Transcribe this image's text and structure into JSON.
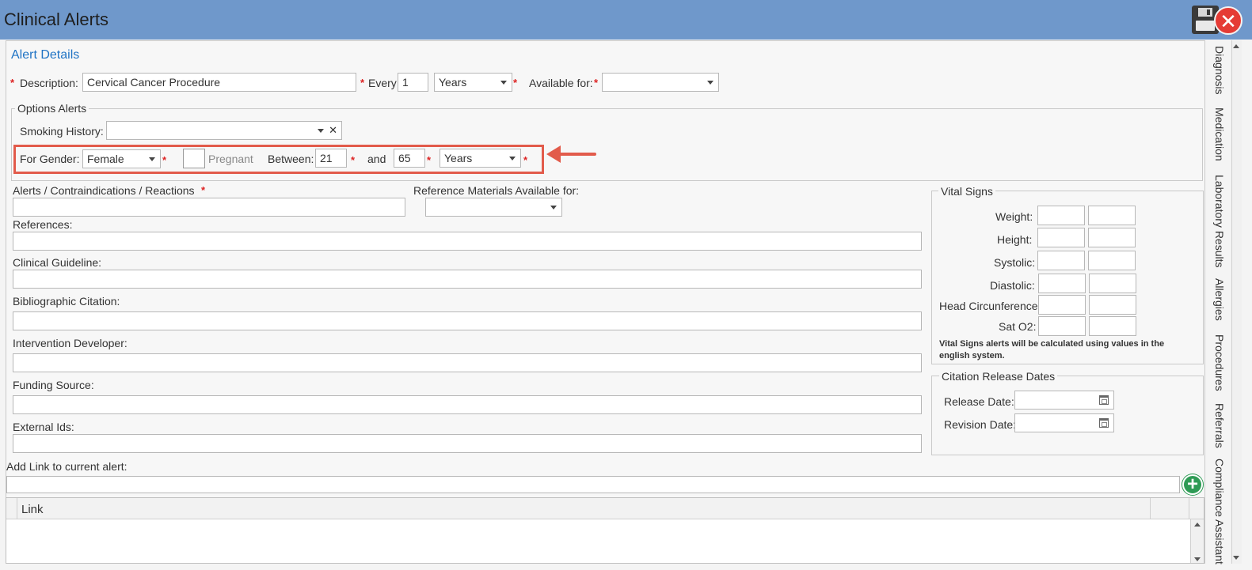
{
  "window": {
    "title": "Clinical Alerts"
  },
  "alert_details": {
    "title": "Alert Details",
    "description_label": "Description:",
    "description_value": "Cervical Cancer Procedure",
    "every_label": "Every:",
    "every_value": "1",
    "every_unit": "Years",
    "available_for_label": "Available for:",
    "available_for_value": "",
    "required_mark": "*"
  },
  "options_alerts": {
    "title": "Options Alerts",
    "smoking_label": "Smoking History:",
    "smoking_value": "",
    "clear_symbol": "✕",
    "gender_label": "For Gender:",
    "gender_value": "Female",
    "pregnant_label": "Pregnant",
    "between_label": "Between:",
    "age_from": "21",
    "and_label": "and",
    "age_to": "65",
    "age_unit": "Years"
  },
  "fields": {
    "alerts_label": "Alerts / Contraindications / Reactions",
    "reference_materials_label": "Reference Materials Available for:",
    "references_label": "References:",
    "clinical_guideline_label": "Clinical Guideline:",
    "bibliographic_label": "Bibliographic Citation:",
    "intervention_label": "Intervention Developer:",
    "funding_label": "Funding Source:",
    "external_ids_label": "External Ids:",
    "add_link_label": "Add Link to current alert:"
  },
  "vital_signs": {
    "title": "Vital Signs",
    "rows": [
      "Weight:",
      "Height:",
      "Systolic:",
      "Diastolic:",
      "Head Circunference:",
      "Sat O2:"
    ],
    "note": "Vital Signs alerts will be calculated using values in the english system."
  },
  "citation_release": {
    "title": "Citation Release Dates",
    "release_label": "Release Date:",
    "revision_label": "Revision Date:"
  },
  "link_grid": {
    "column_link": "Link"
  },
  "side_tabs": [
    "Diagnosis",
    "Medication",
    "Laboratory Results",
    "Allergies",
    "Procedures",
    "Referrals",
    "Compliance Assistant"
  ],
  "icons": {
    "save": "save-icon",
    "close": "close-icon",
    "add": "plus-icon",
    "calendar": "calendar-icon"
  },
  "colors": {
    "titlebar": "#6f98cb",
    "accent": "#1f73c4",
    "required": "#dd2222",
    "highlight": "#e25b4b",
    "add": "#2e9b55",
    "close": "#e53b35"
  }
}
